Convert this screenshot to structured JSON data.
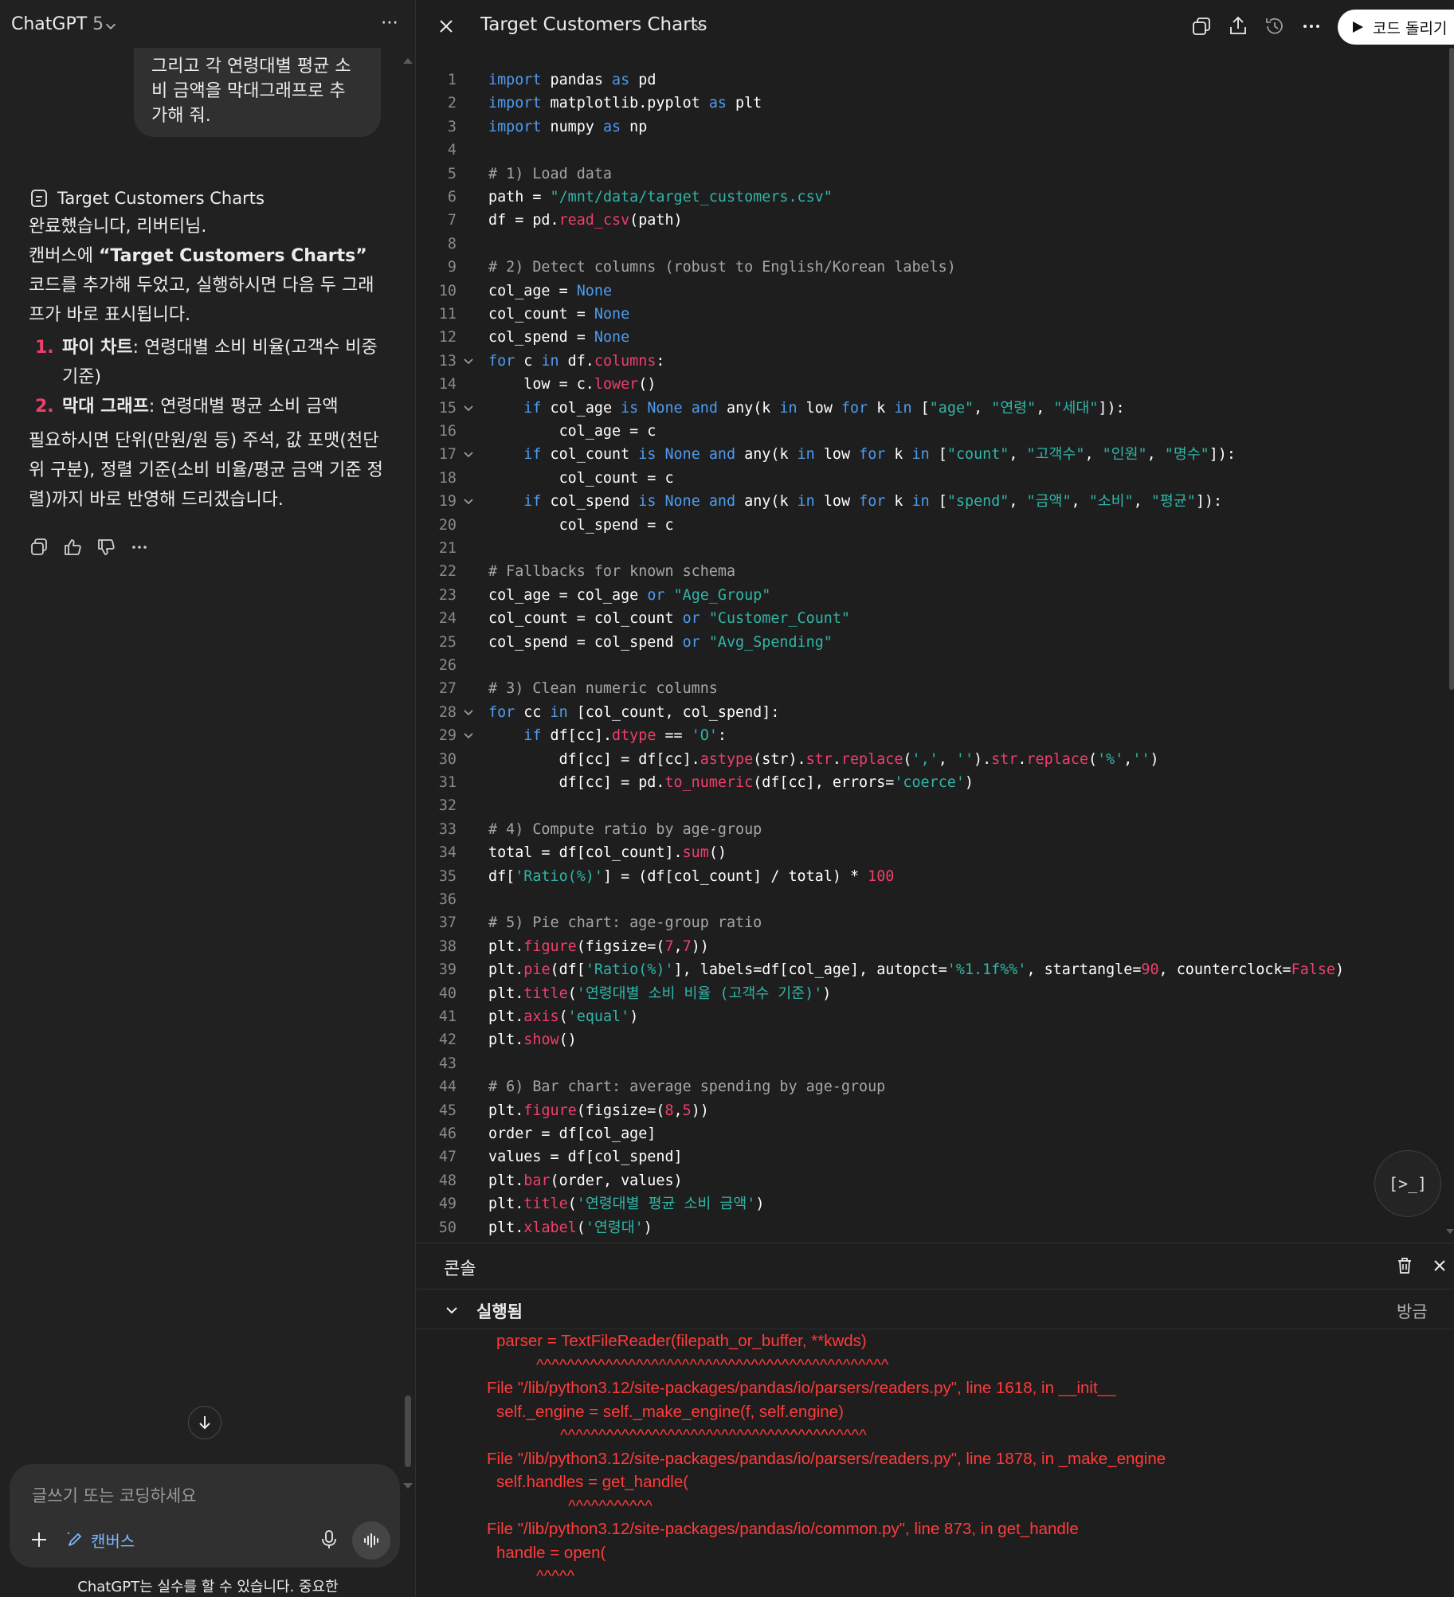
{
  "left": {
    "model": {
      "name": "ChatGPT",
      "version": "5"
    },
    "user_message": "그리고 각 연령대별 평균 소\n비 금액을 막대그래프로 추\n가해 줘.",
    "canvas_ref_label": "Target Customers Charts",
    "reply": {
      "line1": "완료했습니다, 리버티님.",
      "p2_before": "캔버스에 ",
      "p2_bold": "“Target Customers Charts”",
      "p2_after": " 코드를 추가해 두었고, 실행하시면 다음 두 그래프가 바로 표시됩니다.",
      "items": [
        {
          "num": "1.",
          "bold": "파이 차트",
          "text": ": 연령대별 소비 비율(고객수 비중 기준)"
        },
        {
          "num": "2.",
          "bold": "막대 그래프",
          "text": ": 연령대별 평균 소비 금액"
        }
      ],
      "p3": "필요하시면 단위(만원/원 등) 주석, 값 포맷(천단위 구분), 정렬 기준(소비 비율/평균 금액 기준 정렬)까지 바로 반영해 드리겠습니다."
    },
    "composer": {
      "placeholder": "글쓰기 또는 코딩하세요",
      "canvas_tool_label": "캔버스"
    },
    "disclaimer": "ChatGPT는 실수를 할 수 있습니다. 중요한"
  },
  "canvas": {
    "title": "Target Customers Charts",
    "run_label": "코드 돌리기",
    "code_lines": [
      [
        [
          "kw",
          "import"
        ],
        [
          "t",
          " pandas "
        ],
        [
          "kw",
          "as"
        ],
        [
          "t",
          " pd"
        ]
      ],
      [
        [
          "kw",
          "import"
        ],
        [
          "t",
          " matplotlib.pyplot "
        ],
        [
          "kw",
          "as"
        ],
        [
          "t",
          " plt"
        ]
      ],
      [
        [
          "kw",
          "import"
        ],
        [
          "t",
          " numpy "
        ],
        [
          "kw",
          "as"
        ],
        [
          "t",
          " np"
        ]
      ],
      [],
      [
        [
          "cm",
          "# 1) Load data"
        ]
      ],
      [
        [
          "t",
          "path = "
        ],
        [
          "str",
          "\"/mnt/data/target_customers.csv\""
        ]
      ],
      [
        [
          "t",
          "df = pd."
        ],
        [
          "fn",
          "read_csv"
        ],
        [
          "t",
          "(path)"
        ]
      ],
      [],
      [
        [
          "cm",
          "# 2) Detect columns (robust to English/Korean labels)"
        ]
      ],
      [
        [
          "t",
          "col_age = "
        ],
        [
          "kw",
          "None"
        ]
      ],
      [
        [
          "t",
          "col_count = "
        ],
        [
          "kw",
          "None"
        ]
      ],
      [
        [
          "t",
          "col_spend = "
        ],
        [
          "kw",
          "None"
        ]
      ],
      [
        [
          "kw",
          "for"
        ],
        [
          "t",
          " c "
        ],
        [
          "kw",
          "in"
        ],
        [
          "t",
          " df."
        ],
        [
          "fn",
          "columns"
        ],
        [
          "t",
          ":"
        ]
      ],
      [
        [
          "t",
          "    low = c."
        ],
        [
          "fn",
          "lower"
        ],
        [
          "t",
          "()"
        ]
      ],
      [
        [
          "t",
          "    "
        ],
        [
          "kw",
          "if"
        ],
        [
          "t",
          " col_age "
        ],
        [
          "kw",
          "is"
        ],
        [
          "t",
          " "
        ],
        [
          "kw",
          "None"
        ],
        [
          "t",
          " "
        ],
        [
          "kw",
          "and"
        ],
        [
          "t",
          " any(k "
        ],
        [
          "kw",
          "in"
        ],
        [
          "t",
          " low "
        ],
        [
          "kw",
          "for"
        ],
        [
          "t",
          " k "
        ],
        [
          "kw",
          "in"
        ],
        [
          "t",
          " ["
        ],
        [
          "str",
          "\"age\""
        ],
        [
          "t",
          ", "
        ],
        [
          "str",
          "\"연령\""
        ],
        [
          "t",
          ", "
        ],
        [
          "str",
          "\"세대\""
        ],
        [
          "t",
          "]):"
        ]
      ],
      [
        [
          "t",
          "        col_age = c"
        ]
      ],
      [
        [
          "t",
          "    "
        ],
        [
          "kw",
          "if"
        ],
        [
          "t",
          " col_count "
        ],
        [
          "kw",
          "is"
        ],
        [
          "t",
          " "
        ],
        [
          "kw",
          "None"
        ],
        [
          "t",
          " "
        ],
        [
          "kw",
          "and"
        ],
        [
          "t",
          " any(k "
        ],
        [
          "kw",
          "in"
        ],
        [
          "t",
          " low "
        ],
        [
          "kw",
          "for"
        ],
        [
          "t",
          " k "
        ],
        [
          "kw",
          "in"
        ],
        [
          "t",
          " ["
        ],
        [
          "str",
          "\"count\""
        ],
        [
          "t",
          ", "
        ],
        [
          "str",
          "\"고객수\""
        ],
        [
          "t",
          ", "
        ],
        [
          "str",
          "\"인원\""
        ],
        [
          "t",
          ", "
        ],
        [
          "str",
          "\"명수\""
        ],
        [
          "t",
          "]):"
        ]
      ],
      [
        [
          "t",
          "        col_count = c"
        ]
      ],
      [
        [
          "t",
          "    "
        ],
        [
          "kw",
          "if"
        ],
        [
          "t",
          " col_spend "
        ],
        [
          "kw",
          "is"
        ],
        [
          "t",
          " "
        ],
        [
          "kw",
          "None"
        ],
        [
          "t",
          " "
        ],
        [
          "kw",
          "and"
        ],
        [
          "t",
          " any(k "
        ],
        [
          "kw",
          "in"
        ],
        [
          "t",
          " low "
        ],
        [
          "kw",
          "for"
        ],
        [
          "t",
          " k "
        ],
        [
          "kw",
          "in"
        ],
        [
          "t",
          " ["
        ],
        [
          "str",
          "\"spend\""
        ],
        [
          "t",
          ", "
        ],
        [
          "str",
          "\"금액\""
        ],
        [
          "t",
          ", "
        ],
        [
          "str",
          "\"소비\""
        ],
        [
          "t",
          ", "
        ],
        [
          "str",
          "\"평균\""
        ],
        [
          "t",
          "]):"
        ]
      ],
      [
        [
          "t",
          "        col_spend = c"
        ]
      ],
      [],
      [
        [
          "cm",
          "# Fallbacks for known schema"
        ]
      ],
      [
        [
          "t",
          "col_age = col_age "
        ],
        [
          "kw",
          "or"
        ],
        [
          "t",
          " "
        ],
        [
          "str",
          "\"Age_Group\""
        ]
      ],
      [
        [
          "t",
          "col_count = col_count "
        ],
        [
          "kw",
          "or"
        ],
        [
          "t",
          " "
        ],
        [
          "str",
          "\"Customer_Count\""
        ]
      ],
      [
        [
          "t",
          "col_spend = col_spend "
        ],
        [
          "kw",
          "or"
        ],
        [
          "t",
          " "
        ],
        [
          "str",
          "\"Avg_Spending\""
        ]
      ],
      [],
      [
        [
          "cm",
          "# 3) Clean numeric columns"
        ]
      ],
      [
        [
          "kw",
          "for"
        ],
        [
          "t",
          " cc "
        ],
        [
          "kw",
          "in"
        ],
        [
          "t",
          " [col_count, col_spend]:"
        ]
      ],
      [
        [
          "t",
          "    "
        ],
        [
          "kw",
          "if"
        ],
        [
          "t",
          " df[cc]."
        ],
        [
          "fn",
          "dtype"
        ],
        [
          "t",
          " == "
        ],
        [
          "str",
          "'O'"
        ],
        [
          "t",
          ":"
        ]
      ],
      [
        [
          "t",
          "        df[cc] = df[cc]."
        ],
        [
          "fn",
          "astype"
        ],
        [
          "t",
          "(str)."
        ],
        [
          "fn",
          "str"
        ],
        [
          "t",
          "."
        ],
        [
          "fn",
          "replace"
        ],
        [
          "t",
          "("
        ],
        [
          "str",
          "','"
        ],
        [
          "t",
          ", "
        ],
        [
          "str",
          "''"
        ],
        [
          "t",
          ")."
        ],
        [
          "fn",
          "str"
        ],
        [
          "t",
          "."
        ],
        [
          "fn",
          "replace"
        ],
        [
          "t",
          "("
        ],
        [
          "str",
          "'%'"
        ],
        [
          "t",
          ","
        ],
        [
          "str",
          "''"
        ],
        [
          "t",
          ")"
        ]
      ],
      [
        [
          "t",
          "        df[cc] = pd."
        ],
        [
          "fn",
          "to_numeric"
        ],
        [
          "t",
          "(df[cc], errors="
        ],
        [
          "str",
          "'coerce'"
        ],
        [
          "t",
          ")"
        ]
      ],
      [],
      [
        [
          "cm",
          "# 4) Compute ratio by age-group"
        ]
      ],
      [
        [
          "t",
          "total = df[col_count]."
        ],
        [
          "fn",
          "sum"
        ],
        [
          "t",
          "()"
        ]
      ],
      [
        [
          "t",
          "df["
        ],
        [
          "str",
          "'Ratio(%)'"
        ],
        [
          "t",
          "] = (df[col_count] / total) * "
        ],
        [
          "num",
          "100"
        ]
      ],
      [],
      [
        [
          "cm",
          "# 5) Pie chart: age-group ratio"
        ]
      ],
      [
        [
          "t",
          "plt."
        ],
        [
          "fn",
          "figure"
        ],
        [
          "t",
          "(figsize=("
        ],
        [
          "num",
          "7"
        ],
        [
          "t",
          ","
        ],
        [
          "num",
          "7"
        ],
        [
          "t",
          "))"
        ]
      ],
      [
        [
          "t",
          "plt."
        ],
        [
          "fn",
          "pie"
        ],
        [
          "t",
          "(df["
        ],
        [
          "str",
          "'Ratio(%)'"
        ],
        [
          "t",
          "], labels=df[col_age], autopct="
        ],
        [
          "str",
          "'%1.1f%%'"
        ],
        [
          "t",
          ", startangle="
        ],
        [
          "num",
          "90"
        ],
        [
          "t",
          ", counterclock="
        ],
        [
          "num",
          "False"
        ],
        [
          "t",
          ")"
        ]
      ],
      [
        [
          "t",
          "plt."
        ],
        [
          "fn",
          "title"
        ],
        [
          "t",
          "("
        ],
        [
          "str",
          "'연령대별 소비 비율 (고객수 기준)'"
        ],
        [
          "t",
          ")"
        ]
      ],
      [
        [
          "t",
          "plt."
        ],
        [
          "fn",
          "axis"
        ],
        [
          "t",
          "("
        ],
        [
          "str",
          "'equal'"
        ],
        [
          "t",
          ")"
        ]
      ],
      [
        [
          "t",
          "plt."
        ],
        [
          "fn",
          "show"
        ],
        [
          "t",
          "()"
        ]
      ],
      [],
      [
        [
          "cm",
          "# 6) Bar chart: average spending by age-group"
        ]
      ],
      [
        [
          "t",
          "plt."
        ],
        [
          "fn",
          "figure"
        ],
        [
          "t",
          "(figsize=("
        ],
        [
          "num",
          "8"
        ],
        [
          "t",
          ","
        ],
        [
          "num",
          "5"
        ],
        [
          "t",
          "))"
        ]
      ],
      [
        [
          "t",
          "order = df[col_age]"
        ]
      ],
      [
        [
          "t",
          "values = df[col_spend]"
        ]
      ],
      [
        [
          "t",
          "plt."
        ],
        [
          "fn",
          "bar"
        ],
        [
          "t",
          "(order, values)"
        ]
      ],
      [
        [
          "t",
          "plt."
        ],
        [
          "fn",
          "title"
        ],
        [
          "t",
          "("
        ],
        [
          "str",
          "'연령대별 평균 소비 금액'"
        ],
        [
          "t",
          ")"
        ]
      ],
      [
        [
          "t",
          "plt."
        ],
        [
          "fn",
          "xlabel"
        ],
        [
          "t",
          "("
        ],
        [
          "str",
          "'연령대'"
        ],
        [
          "t",
          ")"
        ]
      ]
    ],
    "fold_lines": [
      13,
      15,
      17,
      19,
      28,
      29
    ],
    "console": {
      "title": "콘솔",
      "status": "실행됨",
      "time": "방금",
      "trace": [
        {
          "text": "parser = TextFileReader(filepath_or_buffer, **kwds)",
          "indent": 1
        },
        {
          "text": "^^^^^^^^^^^^^^^^^^^^^^^^^^^^^^^^^^^^^^^^^^^^^^",
          "indent": 2
        },
        {
          "text": "File \"/lib/python3.12/site-packages/pandas/io/parsers/readers.py\", line 1618, in __init__",
          "indent": 0
        },
        {
          "text": "self._engine = self._make_engine(f, self.engine)",
          "indent": 1
        },
        {
          "text": "^^^^^^^^^^^^^^^^^^^^^^^^^^^^^^^^^^^^^^^^",
          "indent": 3
        },
        {
          "text": "File \"/lib/python3.12/site-packages/pandas/io/parsers/readers.py\", line 1878, in _make_engine",
          "indent": 0
        },
        {
          "text": "self.handles = get_handle(",
          "indent": 1
        },
        {
          "text": "^^^^^^^^^^^",
          "indent": 4
        },
        {
          "text": "File \"/lib/python3.12/site-packages/pandas/io/common.py\", line 873, in get_handle",
          "indent": 0
        },
        {
          "text": "handle = open(",
          "indent": 1
        },
        {
          "text": "^^^^^",
          "indent": 2
        }
      ]
    }
  },
  "colors": {
    "keyword": "#4e9cf0",
    "string": "#2fb6a8",
    "function": "#ef3f6b",
    "comment": "#a6a6a6",
    "error": "#ff3b3b",
    "link": "#7ab7ff"
  }
}
